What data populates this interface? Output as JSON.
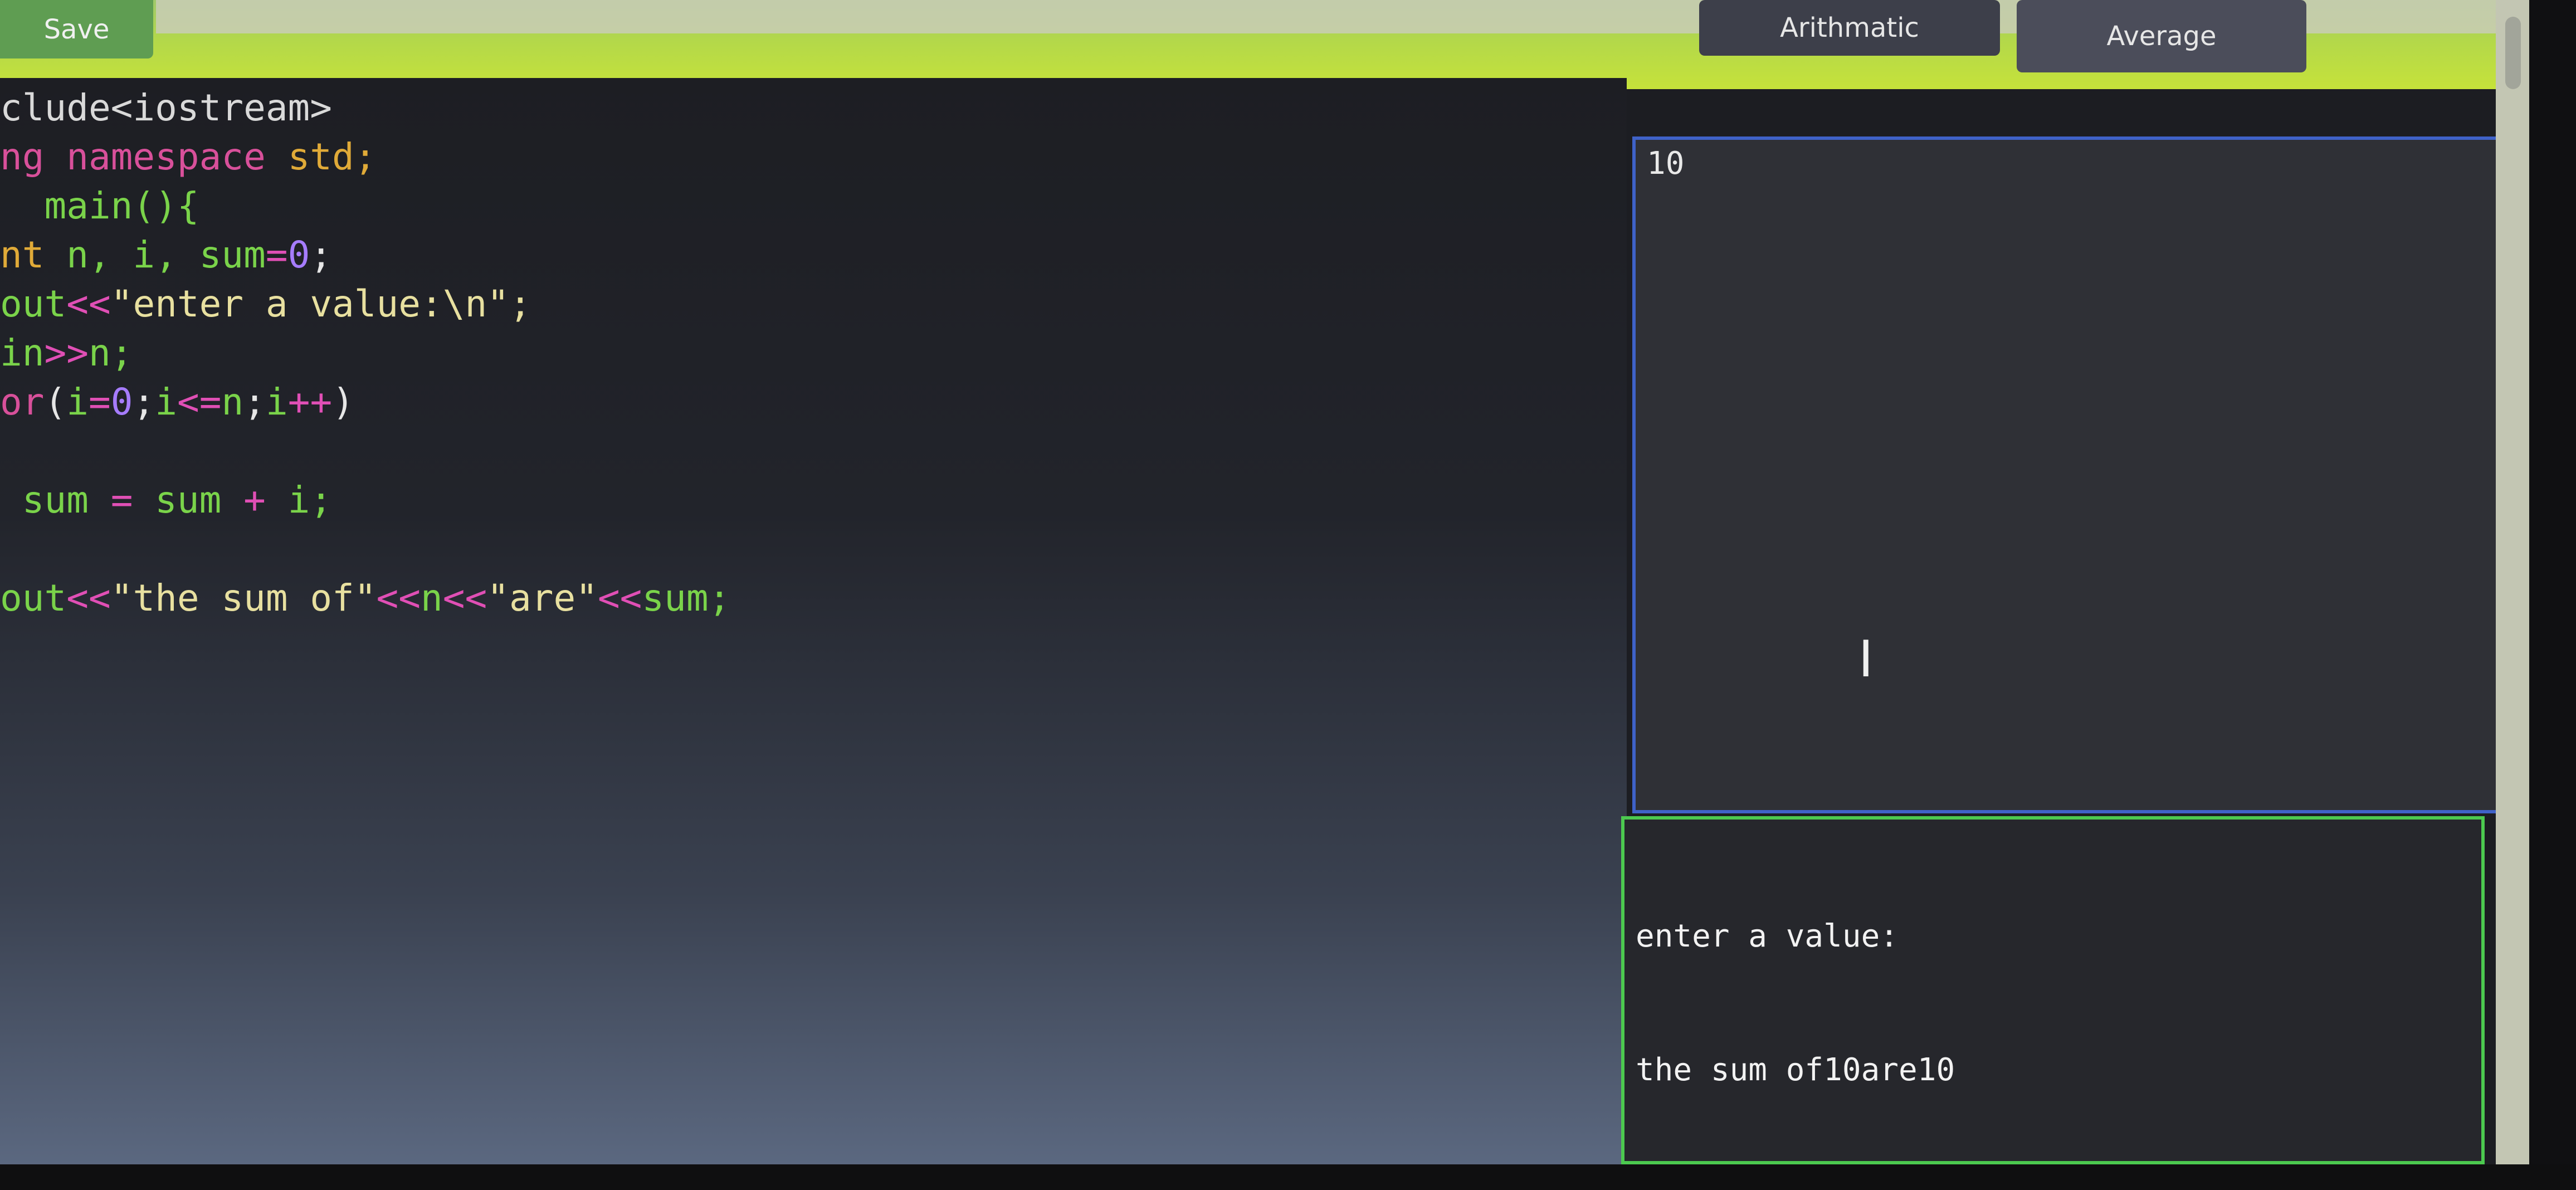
{
  "toolbar": {
    "save_label": "Save",
    "arith_label": "Arithmatic",
    "avg_label": "Average"
  },
  "editor": {
    "lines": [
      [
        {
          "t": "clude<iostream>",
          "c": "c-inc"
        }
      ],
      [
        {
          "t": "ng namespace ",
          "c": "c-kw"
        },
        {
          "t": "std;",
          "c": "c-kw2"
        }
      ],
      [
        {
          "t": "  main(){",
          "c": "c-green"
        }
      ],
      [
        {
          "t": "nt ",
          "c": "c-kw2"
        },
        {
          "t": "n, i, sum",
          "c": "c-green"
        },
        {
          "t": "=",
          "c": "c-op"
        },
        {
          "t": "0",
          "c": "c-num"
        },
        {
          "t": ";",
          "c": "c-plain"
        }
      ],
      [
        {
          "t": "out",
          "c": "c-green"
        },
        {
          "t": "<<",
          "c": "c-op"
        },
        {
          "t": "\"enter a value:\\n\";",
          "c": "c-str"
        }
      ],
      [
        {
          "t": "in",
          "c": "c-green"
        },
        {
          "t": ">>",
          "c": "c-op"
        },
        {
          "t": "n;",
          "c": "c-green"
        }
      ],
      [
        {
          "t": "or",
          "c": "c-kw"
        },
        {
          "t": "(",
          "c": "c-plain"
        },
        {
          "t": "i",
          "c": "c-green"
        },
        {
          "t": "=",
          "c": "c-op"
        },
        {
          "t": "0",
          "c": "c-num"
        },
        {
          "t": ";",
          "c": "c-plain"
        },
        {
          "t": "i",
          "c": "c-green"
        },
        {
          "t": "<=",
          "c": "c-op"
        },
        {
          "t": "n",
          "c": "c-green"
        },
        {
          "t": ";",
          "c": "c-plain"
        },
        {
          "t": "i",
          "c": "c-green"
        },
        {
          "t": "++",
          "c": "c-op"
        },
        {
          "t": ")",
          "c": "c-plain"
        }
      ],
      [
        {
          "t": "",
          "c": "c-plain"
        }
      ],
      [
        {
          "t": " sum ",
          "c": "c-green"
        },
        {
          "t": "=",
          "c": "c-op"
        },
        {
          "t": " sum ",
          "c": "c-green"
        },
        {
          "t": "+",
          "c": "c-op"
        },
        {
          "t": " i;",
          "c": "c-green"
        }
      ],
      [
        {
          "t": "",
          "c": "c-plain"
        }
      ],
      [
        {
          "t": "out",
          "c": "c-green"
        },
        {
          "t": "<<",
          "c": "c-op"
        },
        {
          "t": "\"the sum of\"",
          "c": "c-str"
        },
        {
          "t": "<<",
          "c": "c-op"
        },
        {
          "t": "n",
          "c": "c-green"
        },
        {
          "t": "<<",
          "c": "c-op"
        },
        {
          "t": "\"are\"",
          "c": "c-str"
        },
        {
          "t": "<<",
          "c": "c-op"
        },
        {
          "t": "sum;",
          "c": "c-green"
        }
      ]
    ]
  },
  "input_pane": {
    "value": "10"
  },
  "output_pane": {
    "lines": [
      "enter a value:",
      "the sum of10are10"
    ]
  },
  "colors": {
    "toolbar_accent": "#b3d84a",
    "input_border": "#3f62c8",
    "output_border": "#4cc94f"
  },
  "icons": {
    "text_cursor": "I"
  }
}
